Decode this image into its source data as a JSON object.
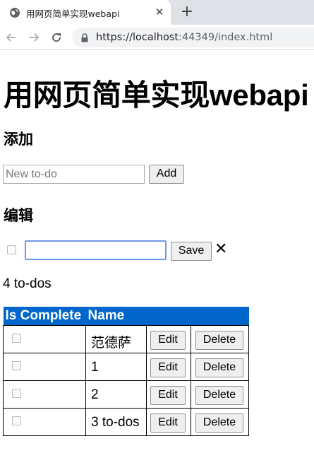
{
  "browser": {
    "tab_title": "用网页简单实现webapi",
    "tab_close": "✕",
    "new_tab": "+",
    "url_host": "https://localhost",
    "url_rest": ":44349/index.html"
  },
  "page": {
    "title": "用网页简单实现webapi",
    "add_section": {
      "heading": "添加",
      "input_placeholder": "New to-do",
      "button_label": "Add"
    },
    "edit_section": {
      "heading": "编辑",
      "input_value": "",
      "save_label": "Save",
      "close_symbol": "✕"
    },
    "counter": "4 to-dos",
    "table": {
      "headers": [
        "Is Complete",
        "Name"
      ],
      "rows": [
        {
          "name": "范德萨",
          "complete": false,
          "edit_label": "Edit",
          "delete_label": "Delete"
        },
        {
          "name": "1",
          "complete": false,
          "edit_label": "Edit",
          "delete_label": "Delete"
        },
        {
          "name": "2",
          "complete": false,
          "edit_label": "Edit",
          "delete_label": "Delete"
        },
        {
          "name": "3 to-dos",
          "complete": false,
          "edit_label": "Edit",
          "delete_label": "Delete"
        }
      ]
    }
  },
  "colors": {
    "table_header_bg": "#0066cc",
    "focus_border": "#6e9be6"
  }
}
